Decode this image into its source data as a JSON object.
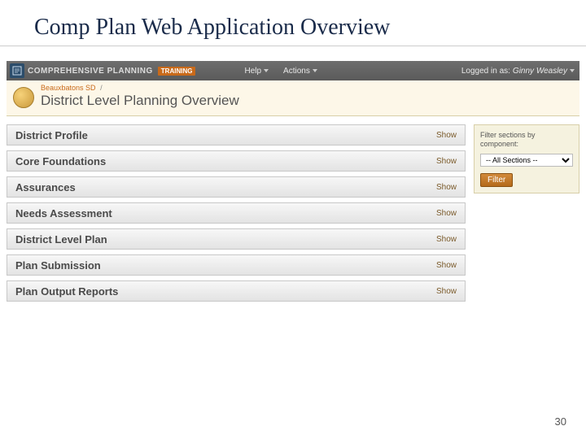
{
  "slide": {
    "title": "Comp Plan Web Application Overview",
    "pageNumber": "30"
  },
  "topbar": {
    "brand": "COMPREHENSIVE PLANNING",
    "badge": "TRAINING",
    "menus": {
      "help": "Help",
      "actions": "Actions"
    },
    "loggedInLabel": "Logged in as:",
    "user": "Ginny Weasley"
  },
  "breadcrumb": {
    "org": "Beauxbatons SD",
    "sep": "/",
    "pageName": "District Level Planning Overview"
  },
  "sections": [
    {
      "label": "District Profile",
      "action": "Show"
    },
    {
      "label": "Core Foundations",
      "action": "Show"
    },
    {
      "label": "Assurances",
      "action": "Show"
    },
    {
      "label": "Needs Assessment",
      "action": "Show"
    },
    {
      "label": "District Level Plan",
      "action": "Show"
    },
    {
      "label": "Plan Submission",
      "action": "Show"
    },
    {
      "label": "Plan Output Reports",
      "action": "Show"
    }
  ],
  "filter": {
    "label": "Filter sections by component:",
    "selected": "-- All Sections --",
    "button": "Filter"
  }
}
